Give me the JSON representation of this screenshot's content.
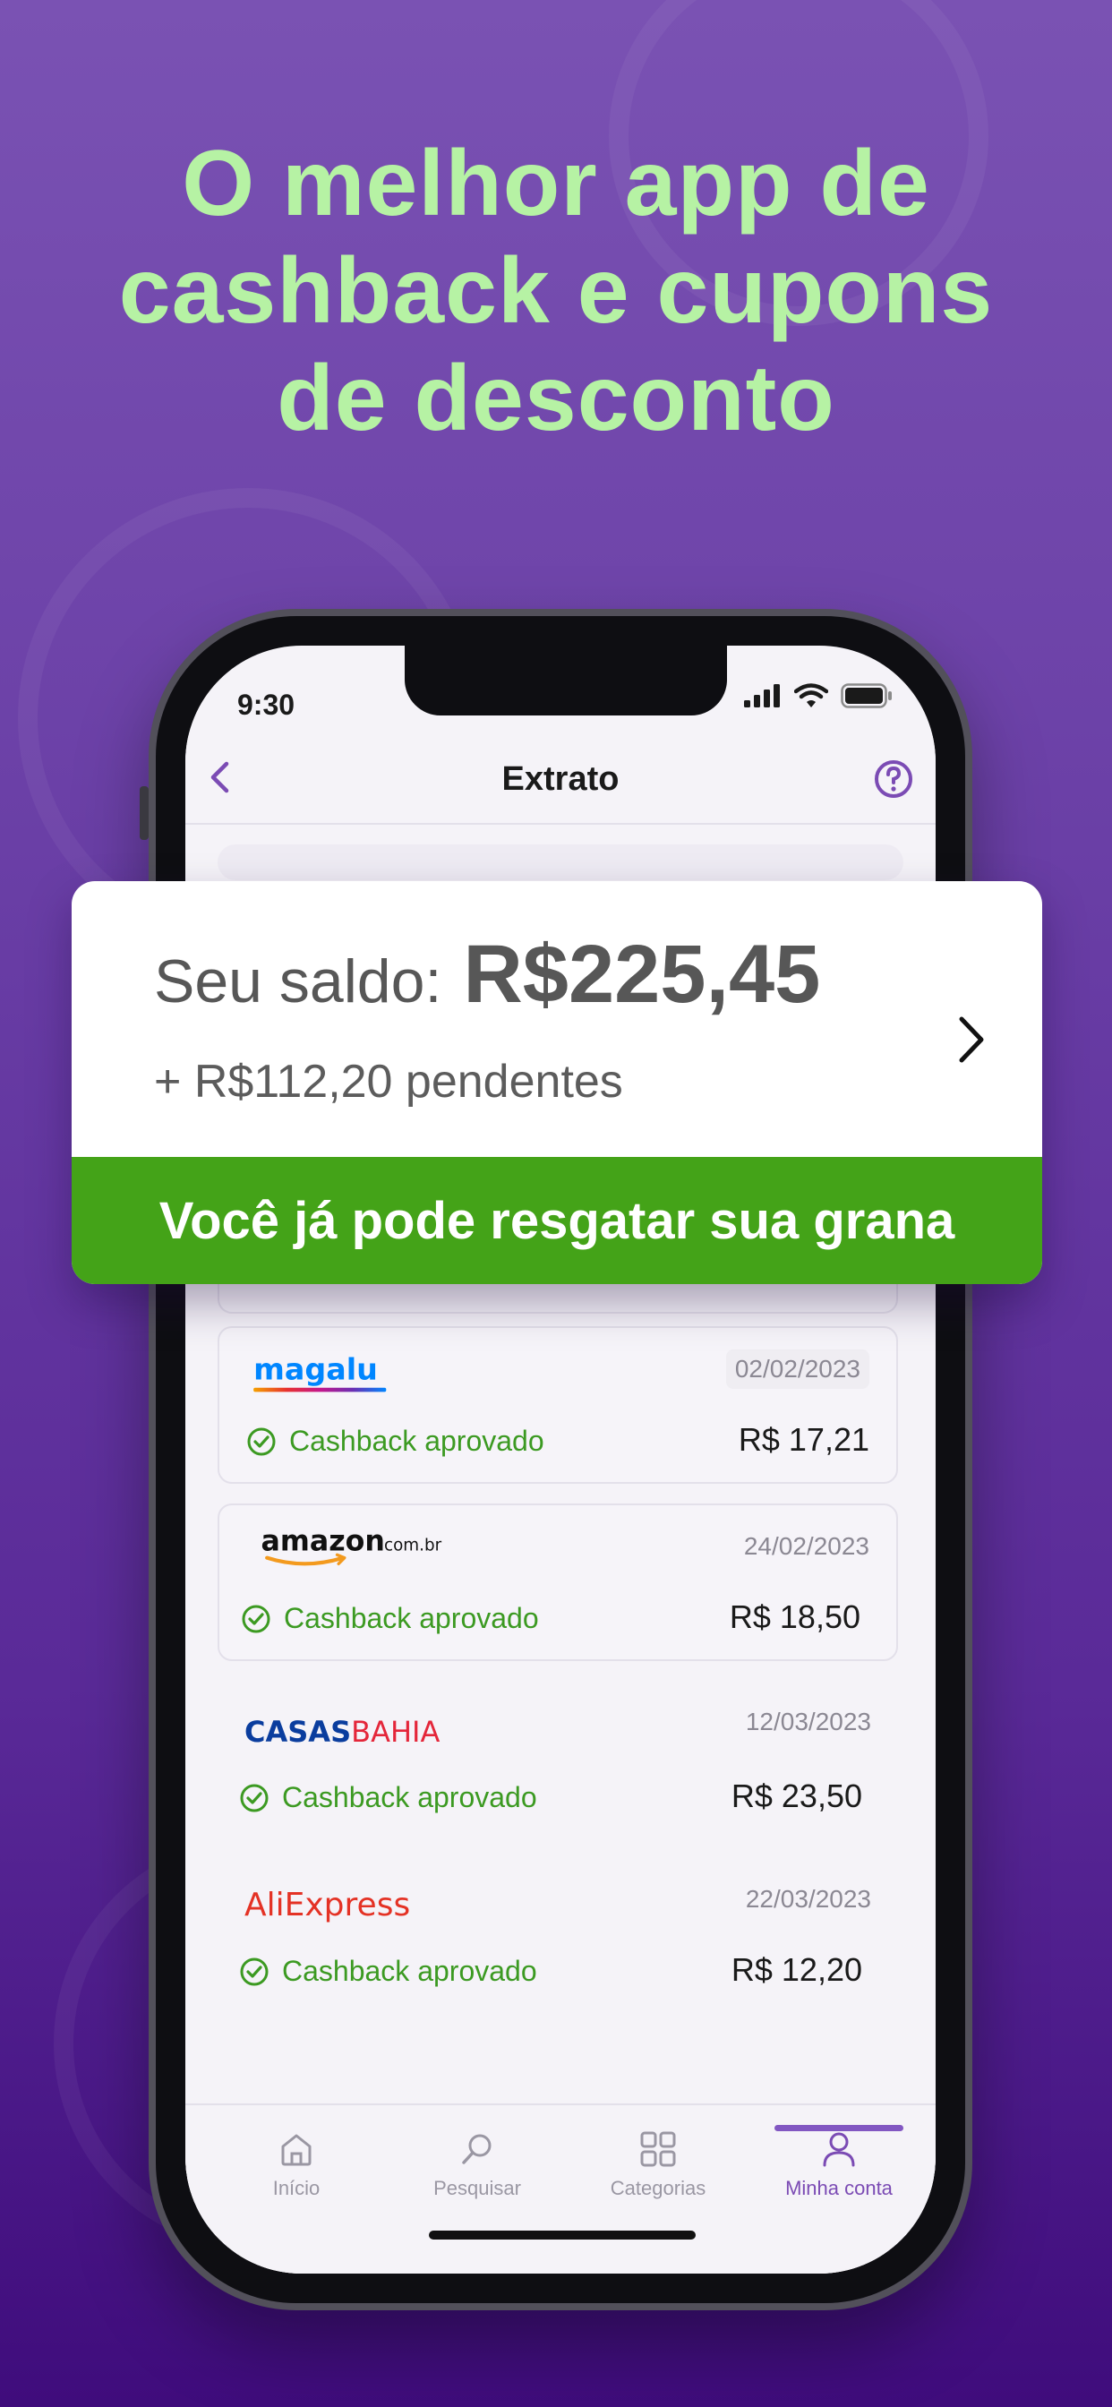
{
  "headline": {
    "line1": "O melhor app de",
    "line2": "cashback e cupons",
    "line3": "de desconto"
  },
  "status_bar": {
    "time": "9:30"
  },
  "header": {
    "title": "Extrato"
  },
  "balance_card": {
    "label": "Seu saldo:",
    "value": "R$225,45",
    "pending": "+ R$112,20 pendentes",
    "cta": "Você já pode resgatar sua grana"
  },
  "transactions": [
    {
      "store": "magalu",
      "date": "02/02/2023",
      "status": "Cashback aprovado",
      "amount": "R$ 17,21"
    },
    {
      "store": "amazon",
      "store_suffix": ".com.br",
      "date": "24/02/2023",
      "status": "Cashback aprovado",
      "amount": "R$ 18,50"
    },
    {
      "store_part1": "CASAS",
      "store_part2": "BAHIA",
      "date": "12/03/2023",
      "status": "Cashback aprovado",
      "amount": "R$ 23,50"
    },
    {
      "store": "AliExpress",
      "date": "22/03/2023",
      "status": "Cashback aprovado",
      "amount": "R$ 12,20"
    }
  ],
  "tab_bar": {
    "tabs": [
      {
        "label": "Início",
        "icon": "home-icon"
      },
      {
        "label": "Pesquisar",
        "icon": "search-icon"
      },
      {
        "label": "Categorias",
        "icon": "grid-icon"
      },
      {
        "label": "Minha conta",
        "icon": "user-icon"
      }
    ],
    "active_index": 3
  },
  "colors": {
    "background": "#6a3fa6",
    "headline": "#b6f2a4",
    "accent_purple": "#7b4bb4",
    "success_green": "#44a318"
  }
}
